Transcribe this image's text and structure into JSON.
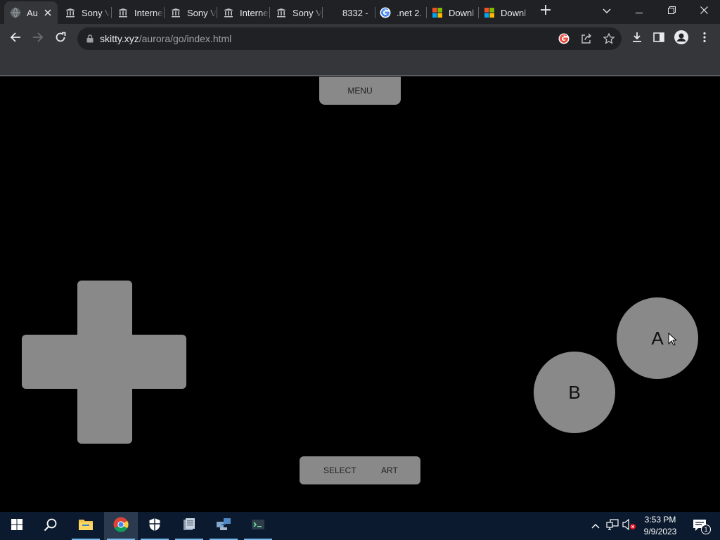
{
  "browser": {
    "tabs": [
      {
        "title": "Au",
        "favicon": "globe-icon",
        "active": true
      },
      {
        "title": "Sony V",
        "favicon": "archive-icon"
      },
      {
        "title": "Interne",
        "favicon": "archive-icon"
      },
      {
        "title": "Sony V",
        "favicon": "archive-icon"
      },
      {
        "title": "Interne",
        "favicon": "archive-icon"
      },
      {
        "title": "Sony V",
        "favicon": "archive-icon"
      },
      {
        "title": "8332 -",
        "favicon": "none"
      },
      {
        "title": ".net 2.",
        "favicon": "google-icon"
      },
      {
        "title": "Downl",
        "favicon": "microsoft-icon"
      },
      {
        "title": "Downl",
        "favicon": "microsoft-icon"
      }
    ],
    "url_host": "skitty.xyz",
    "url_path": "/aurora/go/index.html"
  },
  "emulator": {
    "menu_label": "MENU",
    "a_label": "A",
    "b_label": "B",
    "select_label": "SELECT",
    "start_label": "ART"
  },
  "taskbar": {
    "time": "3:53 PM",
    "date": "9/9/2023",
    "notification_count": "1"
  },
  "colors": {
    "control_gray": "#898989",
    "page_background": "#000000",
    "chrome_dark": "#202124",
    "chrome_toolbar": "#35363a"
  }
}
